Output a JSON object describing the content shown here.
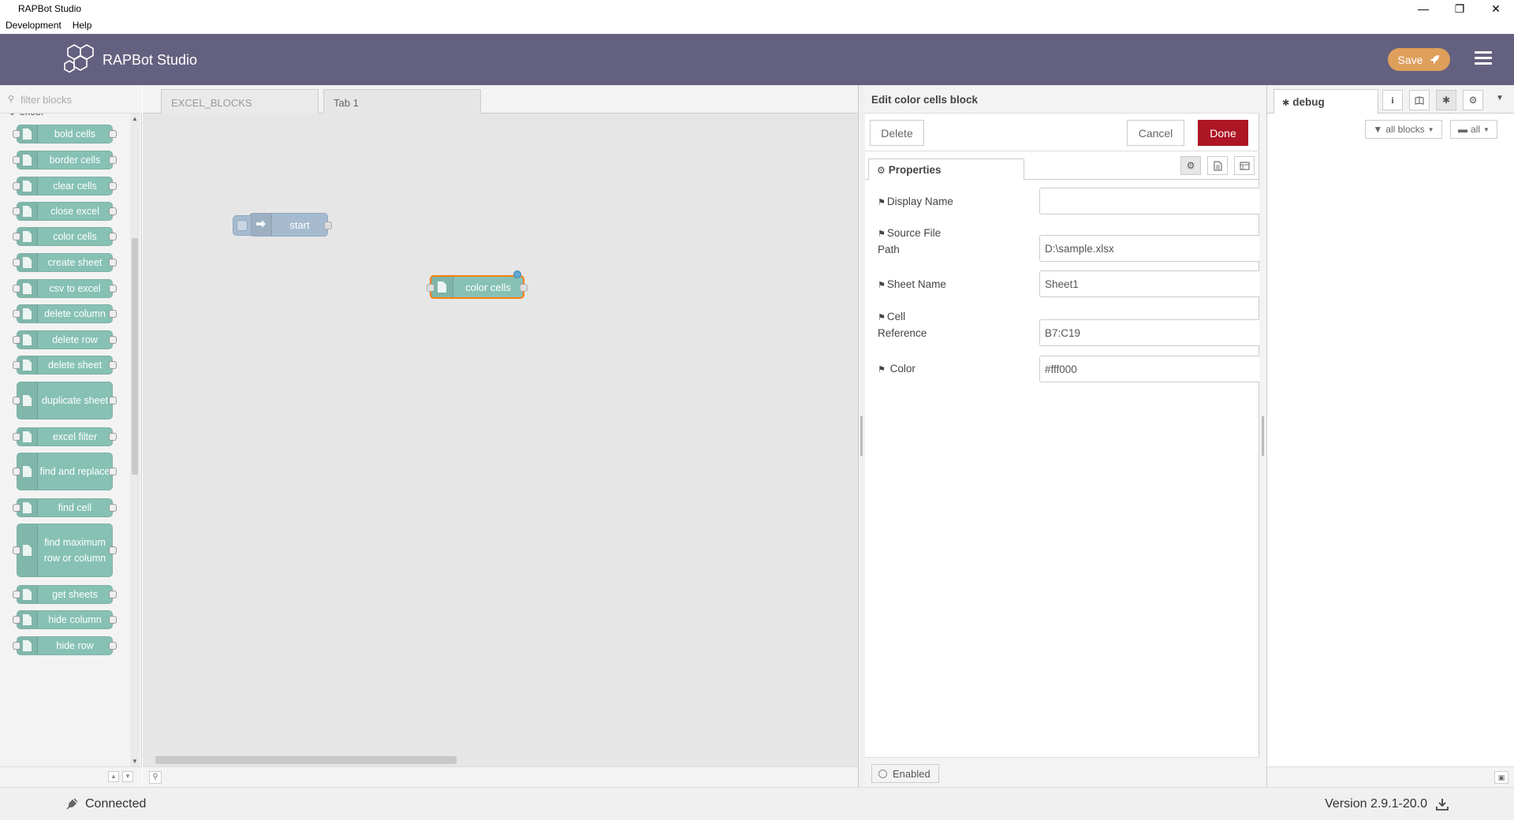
{
  "window": {
    "title": "RAPBot Studio",
    "menus": [
      "Development",
      "Help"
    ]
  },
  "header": {
    "app_name": "RAPBot Studio",
    "save_label": "Save"
  },
  "palette": {
    "filter_placeholder": "filter blocks",
    "category": "excel",
    "items": [
      {
        "label": "bold cells"
      },
      {
        "label": "border cells"
      },
      {
        "label": "clear cells"
      },
      {
        "label": "close excel"
      },
      {
        "label": "color cells"
      },
      {
        "label": "create sheet"
      },
      {
        "label": "csv to excel"
      },
      {
        "label": "delete column"
      },
      {
        "label": "delete row"
      },
      {
        "label": "delete sheet"
      },
      {
        "label": "duplicate sheet"
      },
      {
        "label": "excel filter"
      },
      {
        "label": "find and replace"
      },
      {
        "label": "find cell"
      },
      {
        "label": "find maximum row or column"
      },
      {
        "label": "get sheets"
      },
      {
        "label": "hide column"
      },
      {
        "label": "hide row"
      }
    ]
  },
  "workspace": {
    "tabs": [
      {
        "label": "EXCEL_BLOCKS",
        "active": false
      },
      {
        "label": "Tab 1",
        "active": true
      }
    ],
    "nodes": [
      {
        "label": "start",
        "type": "inject"
      },
      {
        "label": "color cells",
        "type": "excel",
        "selected": true
      }
    ]
  },
  "editor": {
    "title": "Edit color cells block",
    "delete_label": "Delete",
    "cancel_label": "Cancel",
    "done_label": "Done",
    "properties_tab": "Properties",
    "fields": {
      "display_name": {
        "label": "Display Name",
        "value": ""
      },
      "source_file_path": {
        "label": "Source File Path",
        "value": "D:\\sample.xlsx"
      },
      "sheet_name": {
        "label": "Sheet Name",
        "value": "Sheet1"
      },
      "cell_reference": {
        "label": "Cell Reference",
        "value": "B7:C19"
      },
      "color": {
        "label": "Color",
        "value": "#fff000"
      }
    },
    "enabled_label": "Enabled"
  },
  "sidebar": {
    "active_tab": "debug",
    "filter_label": "all blocks",
    "clear_label": "all"
  },
  "status": {
    "connection": "Connected",
    "version": "Version 2.9.1-20.0"
  },
  "colors": {
    "header_bg": "#646180",
    "save_btn": "#de9f5b",
    "done_btn": "#ad1625",
    "node_excel": "#86c1b4",
    "node_inject": "#a6bbcf"
  }
}
